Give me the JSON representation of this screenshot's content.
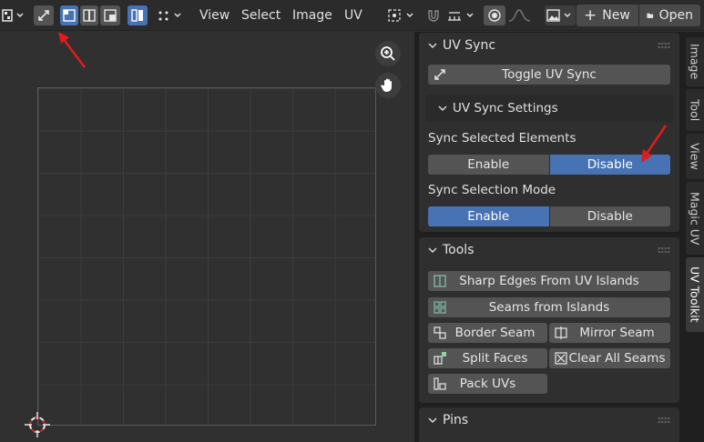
{
  "header": {
    "menus": [
      "View",
      "Select",
      "Image",
      "UV"
    ],
    "new_label": "New",
    "open_label": "Open"
  },
  "sidebar_tabs": [
    "Image",
    "Tool",
    "View",
    "Magic UV",
    "UV Toolkit"
  ],
  "panels": {
    "uv_sync": {
      "title": "UV Sync",
      "toggle_label": "Toggle UV Sync",
      "settings_title": "UV Sync Settings",
      "sync_selected_label": "Sync Selected Elements",
      "sync_selected_options": [
        "Enable",
        "Disable"
      ],
      "sync_selected_active": "Disable",
      "sync_mode_label": "Sync Selection Mode",
      "sync_mode_options": [
        "Enable",
        "Disable"
      ],
      "sync_mode_active": "Enable"
    },
    "tools": {
      "title": "Tools",
      "sharp_edges": "Sharp Edges From UV Islands",
      "seams_from_islands": "Seams from Islands",
      "border_seam": "Border Seam",
      "mirror_seam": "Mirror Seam",
      "split_faces": "Split Faces",
      "clear_all_seams": "Clear All Seams",
      "pack_uvs": "Pack UVs"
    },
    "pins": {
      "title": "Pins"
    }
  },
  "colors": {
    "accent_blue": "#4772b3",
    "annotation_red": "#e21b1b"
  }
}
